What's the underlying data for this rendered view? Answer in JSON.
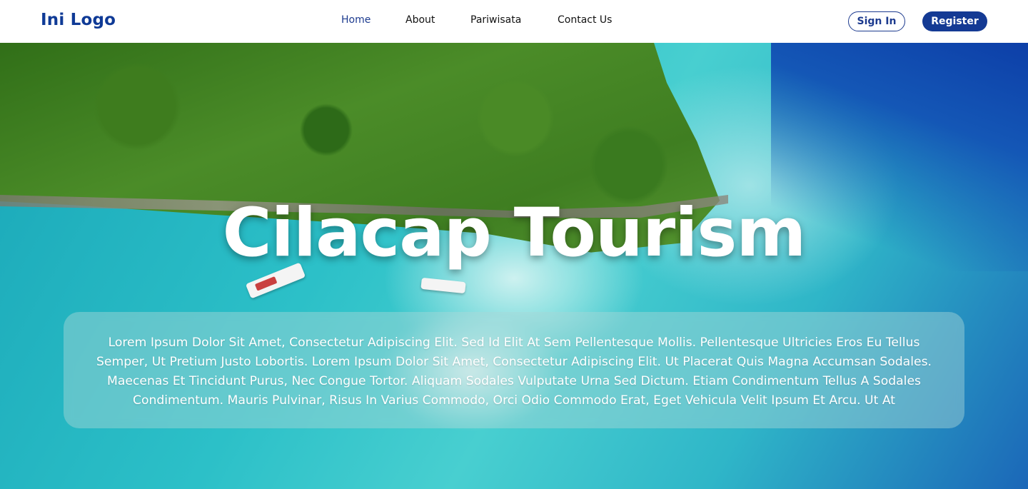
{
  "header": {
    "logo": "Ini Logo",
    "nav": [
      {
        "label": "Home",
        "active": true
      },
      {
        "label": "About",
        "active": false
      },
      {
        "label": "Pariwisata",
        "active": false
      },
      {
        "label": "Contact Us",
        "active": false
      }
    ],
    "sign_in_label": "Sign In",
    "register_label": "Register"
  },
  "hero": {
    "title": "Cilacap Tourism",
    "description": "Lorem Ipsum Dolor Sit Amet, Consectetur Adipiscing Elit. Sed Id Elit At Sem Pellentesque Mollis. Pellentesque Ultricies Eros Eu Tellus Semper, Ut Pretium Justo Lobortis. Lorem Ipsum Dolor Sit Amet, Consectetur Adipiscing Elit. Ut Placerat Quis Magna Accumsan Sodales. Maecenas Et Tincidunt Purus, Nec Congue Tortor. Aliquam Sodales Vulputate Urna Sed Dictum. Etiam Condimentum Tellus A Sodales Condimentum. Mauris Pulvinar, Risus In Varius Commodo, Orci Odio Commodo Erat, Eget Vehicula Velit Ipsum Et Arcu. Ut At"
  },
  "colors": {
    "brand_blue": "#143a94",
    "nav_active": "#1d3b8f"
  }
}
